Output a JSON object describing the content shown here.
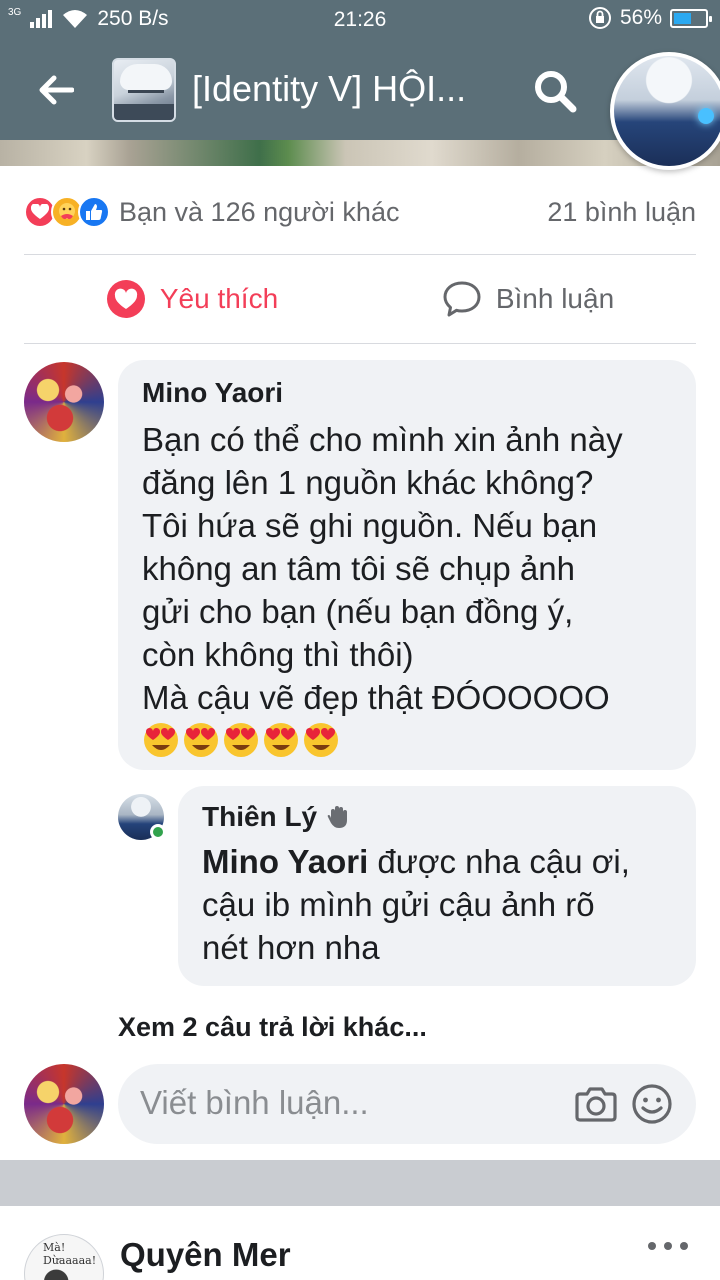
{
  "status_bar": {
    "network": "3G",
    "speed": "250 B/s",
    "time": "21:26",
    "battery": "56%",
    "battery_level": 0.56
  },
  "header": {
    "title": "[Identity V] HỘI...",
    "back_icon": "arrow-left-icon",
    "search_icon": "search-icon"
  },
  "post": {
    "reactions": [
      "love",
      "care",
      "like"
    ],
    "reaction_summary": "Bạn và 126 người khác",
    "comment_count": "21 bình luận",
    "actions": {
      "like_label": "Yêu thích",
      "comment_label": "Bình luận"
    }
  },
  "comments": [
    {
      "author": "Mino Yaori",
      "lines": [
        "Bạn có thể cho mình xin ảnh này",
        "đăng lên 1 nguồn khác không?",
        "Tôi hứa sẽ ghi nguồn. Nếu bạn",
        "không an tâm tôi sẽ chụp ảnh",
        "gửi cho bạn (nếu bạn đồng ý,",
        "còn không thì thôi)",
        "Mà cậu vẽ đẹp thật ĐÓOOOOO"
      ],
      "emoji_count": 5
    }
  ],
  "reply": {
    "author": "Thiên Lý",
    "badge_icon": "wave-hand-icon",
    "mention": "Mino Yaori",
    "line1": " được nha cậu ơi,",
    "line2": "cậu ib mình gửi cậu ảnh rõ",
    "line3": "nét hơn nha"
  },
  "more_replies": "Xem 2 câu trả lời khác...",
  "composer": {
    "placeholder": "Viết bình luận..."
  },
  "next_post": {
    "author": "Quyên Mer",
    "avatar_text": "Mà! Dừaaaaa!"
  },
  "colors": {
    "header_bg": "#5b6f78",
    "love": "#f33e58",
    "like_blue": "#1877f2",
    "bubble_bg": "#f0f2f5",
    "secondary_text": "#65676b"
  }
}
